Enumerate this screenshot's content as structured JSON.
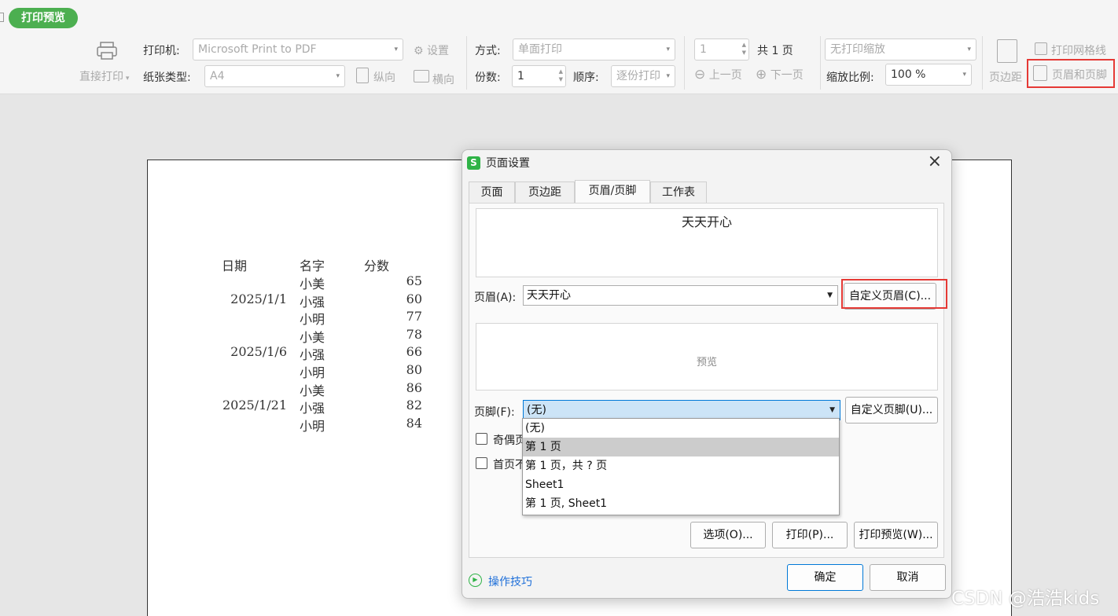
{
  "header": {
    "title": "打印预览"
  },
  "toolbar": {
    "direct_print": "直接打印",
    "printer_label": "打印机:",
    "printer_value": "Microsoft Print to PDF",
    "settings": "设置",
    "paper_label": "纸张类型:",
    "paper_value": "A4",
    "portrait": "纵向",
    "landscape": "横向",
    "mode_label": "方式:",
    "mode_value": "单面打印",
    "copies_label": "份数:",
    "copies_value": "1",
    "order_label": "顺序:",
    "order_value": "逐份打印",
    "page_input": "1",
    "page_total": "共 1 页",
    "prev_page": "上一页",
    "next_page": "下一页",
    "scale_mode": "无打印缩放",
    "scale_label": "缩放比例:",
    "scale_value": "100 %",
    "margins": "页边距",
    "gridlines": "打印网格线",
    "header_footer": "页眉和页脚"
  },
  "sheet": {
    "headers": [
      "日期",
      "名字",
      "分数"
    ],
    "rows": [
      [
        "",
        "小美",
        "65"
      ],
      [
        "2025/1/1",
        "小强",
        "60"
      ],
      [
        "",
        "小明",
        "77"
      ],
      [
        "",
        "小美",
        "78"
      ],
      [
        "2025/1/6",
        "小强",
        "66"
      ],
      [
        "",
        "小明",
        "80"
      ],
      [
        "",
        "小美",
        "86"
      ],
      [
        "2025/1/21",
        "小强",
        "82"
      ],
      [
        "",
        "小明",
        "84"
      ]
    ]
  },
  "dialog": {
    "title": "页面设置",
    "tabs": [
      "页面",
      "页边距",
      "页眉/页脚",
      "工作表"
    ],
    "active_tab": "页眉/页脚",
    "header_preview_text": "天天开心",
    "header_label": "页眉(A):",
    "header_value": "天天开心",
    "custom_header": "自定义页眉(C)...",
    "footer_preview_text": "预览",
    "footer_label": "页脚(F):",
    "footer_value": "(无)",
    "custom_footer": "自定义页脚(U)...",
    "footer_options": [
      "(无)",
      "第 1 页",
      "第 1 页，共 ? 页",
      "Sheet1",
      "第 1 页, Sheet1"
    ],
    "highlighted_option": "第 1 页",
    "checkbox_odd_even": "奇偶页",
    "checkbox_first_page": "首页不",
    "options_button": "选项(O)...",
    "print_button": "打印(P)...",
    "print_preview_button": "打印预览(W)...",
    "tips": "操作技巧",
    "ok": "确定",
    "cancel": "取消"
  },
  "watermark": "CSDN @浩浩kids",
  "colors": {
    "accent_green": "#4caf50",
    "highlight_red": "#e53935",
    "link_blue": "#1e6fd9",
    "focus_blue": "#0078d7"
  }
}
